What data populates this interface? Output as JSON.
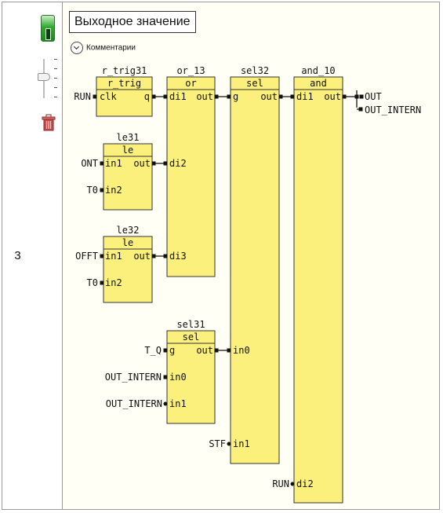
{
  "row": {
    "number": "3"
  },
  "header": {
    "title": "Выходное значение",
    "comments_label": "Комментарии"
  },
  "blocks": {
    "b1": {
      "instance": "r_trig31",
      "type": "r_trig",
      "pins": [
        "clk",
        "q"
      ]
    },
    "b2": {
      "instance": "le31",
      "type": "le",
      "pins": [
        "in1",
        "out",
        "in2"
      ]
    },
    "b3": {
      "instance": "le32",
      "type": "le",
      "pins": [
        "in1",
        "out",
        "in2"
      ]
    },
    "b4": {
      "instance": "or_13",
      "type": "or",
      "pins": [
        "di1",
        "out",
        "di2",
        "di3"
      ]
    },
    "b5": {
      "instance": "sel31",
      "type": "sel",
      "pins": [
        "g",
        "out",
        "in0",
        "in1"
      ]
    },
    "b6": {
      "instance": "sel32",
      "type": "sel",
      "pins": [
        "g",
        "out",
        "in0",
        "in1"
      ]
    },
    "b7": {
      "instance": "and_10",
      "type": "and",
      "pins": [
        "di1",
        "out",
        "di2"
      ]
    }
  },
  "signals": {
    "s1": "RUN",
    "s2": "ONT",
    "s3": "T0",
    "s4": "OFFT",
    "s5": "T0",
    "s6": "T_Q",
    "s7": "OUT_INTERN",
    "s8": "OUT_INTERN",
    "s9": "STF",
    "s10": "RUN",
    "s11": "OUT",
    "s12": "OUT_INTERN"
  },
  "colors": {
    "block_fill": "#fcf07c",
    "block_border": "#333333",
    "toggle": "#2faa2f",
    "trash": "#b33a3a"
  },
  "icons": {
    "toggle": "toggle-switch-icon",
    "slider": "zoom-slider",
    "trash": "trash-icon",
    "chevron": "chevron-down-icon"
  }
}
